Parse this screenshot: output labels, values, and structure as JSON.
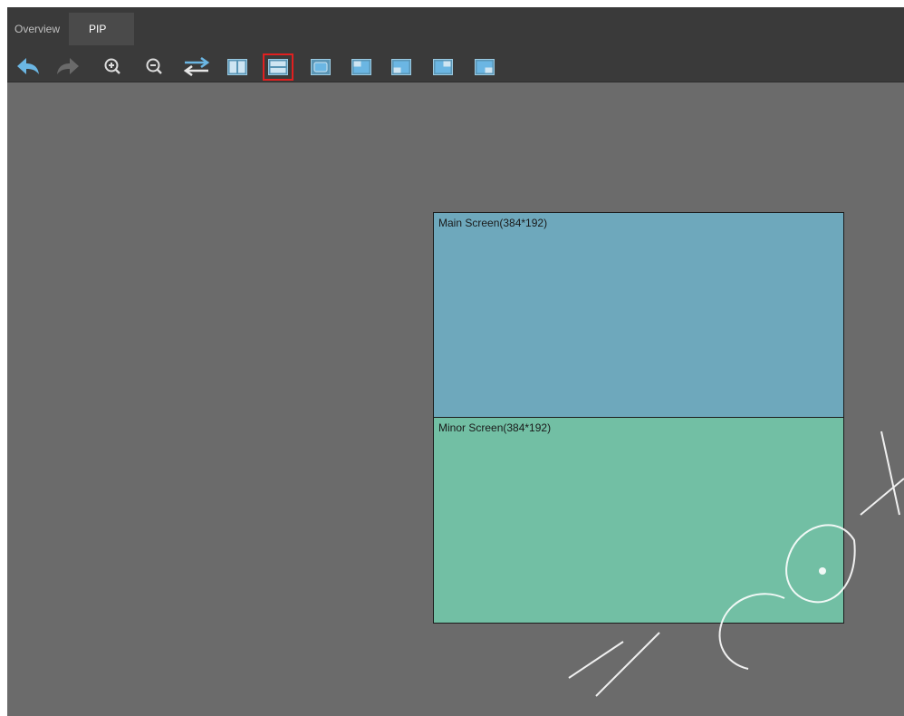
{
  "tabs": [
    {
      "label": "Overview",
      "active": false
    },
    {
      "label": "PIP",
      "active": true
    }
  ],
  "toolbar": {
    "buttons": [
      {
        "name": "undo-icon"
      },
      {
        "name": "redo-icon"
      },
      {
        "name": "zoom-in-icon"
      },
      {
        "name": "zoom-out-icon"
      },
      {
        "name": "swap-icon"
      },
      {
        "name": "layout-side-by-side-icon"
      },
      {
        "name": "layout-top-bottom-icon",
        "selected": true
      },
      {
        "name": "layout-center-pip-icon"
      },
      {
        "name": "layout-top-left-pip-icon"
      },
      {
        "name": "layout-bottom-left-pip-icon"
      },
      {
        "name": "layout-top-right-pip-icon"
      },
      {
        "name": "layout-bottom-right-pip-icon"
      }
    ]
  },
  "canvas": {
    "main_screen": {
      "label": "Main Screen(384*192)"
    },
    "minor_screen": {
      "label": "Minor Screen(384*192)"
    }
  },
  "colors": {
    "workspace": "#6b6b6b",
    "toolbar": "#3a3a3a",
    "main_screen": "#6ea8bc",
    "minor_screen": "#72bfa4",
    "icon_accent": "#6bb6e3",
    "selection": "#e02020"
  }
}
